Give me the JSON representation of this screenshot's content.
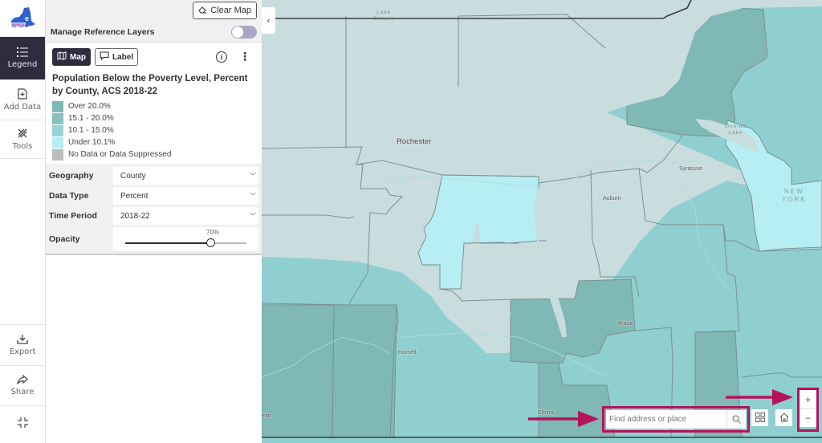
{
  "app": {
    "logo_text": "NYSCAA"
  },
  "rail": {
    "items": [
      {
        "label": "Legend",
        "icon": "list-icon",
        "active": true
      },
      {
        "label": "Add Data",
        "icon": "add-file-icon",
        "active": false
      },
      {
        "label": "Tools",
        "icon": "tools-icon",
        "active": false
      },
      {
        "label": "Export",
        "icon": "download-icon",
        "active": false
      },
      {
        "label": "Share",
        "icon": "share-icon",
        "active": false
      }
    ],
    "collapse_icon": "fullscreen-exit-icon"
  },
  "panel": {
    "clear_map_label": "Clear Map",
    "reference_layers_label": "Manage Reference Layers",
    "reference_layers_on": false,
    "modes": [
      {
        "label": "Map",
        "icon": "map-icon",
        "active": true
      },
      {
        "label": "Label",
        "icon": "label-icon",
        "active": false
      }
    ],
    "layer_title": "Population Below the Poverty Level, Percent by County, ACS 2018-22",
    "legend": [
      {
        "label": "Over 20.0%",
        "color": "#7fb8b5"
      },
      {
        "label": "15.1 - 20.0%",
        "color": "#88c2c0"
      },
      {
        "label": "10.1 - 15.0%",
        "color": "#9ad3d4"
      },
      {
        "label": "Under 10.1%",
        "color": "#b6eef3"
      },
      {
        "label": "No Data or Data Suppressed",
        "color": "#bdbdbd"
      }
    ],
    "settings": {
      "geography": {
        "label": "Geography",
        "value": "County"
      },
      "data_type": {
        "label": "Data Type",
        "value": "Percent"
      },
      "time_period": {
        "label": "Time Period",
        "value": "2018-22"
      },
      "opacity": {
        "label": "Opacity",
        "value": 70,
        "display": "70%"
      }
    }
  },
  "map": {
    "lakes": [
      {
        "name": "Lake Ontario",
        "line1": "Lake",
        "line2": "Ontario"
      },
      {
        "name": "Oneida Lake",
        "line1": "Oneida",
        "line2": "Lake"
      }
    ],
    "state_label": {
      "line1": "NEW",
      "line2": "YORK"
    },
    "cities": [
      {
        "name": "Rochester",
        "major": true
      },
      {
        "name": "Syracuse",
        "major": false
      },
      {
        "name": "Auburn",
        "major": false
      },
      {
        "name": "Ithaca",
        "major": false
      },
      {
        "name": "Hornell",
        "major": false
      },
      {
        "name": "Elmira",
        "major": false
      },
      {
        "name": "Olean",
        "major": false,
        "visible_text": "ean"
      }
    ],
    "search": {
      "placeholder": "Find address or place",
      "value": ""
    },
    "buttons": {
      "basemap": "basemap-gallery-icon",
      "home": "home-icon",
      "zoom_in": "+",
      "zoom_out": "−"
    },
    "highlight_color": "#b5135a"
  }
}
